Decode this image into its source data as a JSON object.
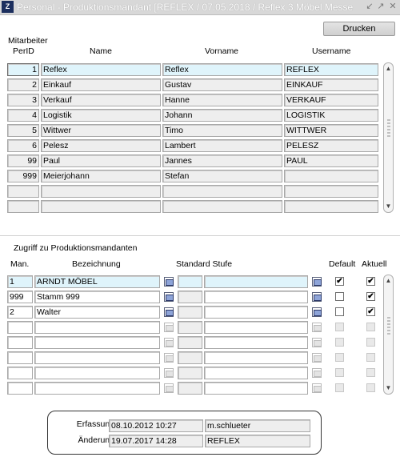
{
  "window": {
    "icon_label": "Z",
    "title": "Personal - Produktionsmandant  [REFLEX / 07.05.2018 / Reflex 3 Möbel Messe"
  },
  "toolbar": {
    "print_label": "Drucken"
  },
  "personal": {
    "label_top": "Mitarbeiter",
    "columns": {
      "perid": "PerID",
      "name": "Name",
      "vorname": "Vorname",
      "username": "Username"
    },
    "rows": [
      {
        "perid": "1",
        "name": "Reflex",
        "vorname": "Reflex",
        "username": "REFLEX"
      },
      {
        "perid": "2",
        "name": "Einkauf",
        "vorname": "Gustav",
        "username": "EINKAUF"
      },
      {
        "perid": "3",
        "name": "Verkauf",
        "vorname": "Hanne",
        "username": "VERKAUF"
      },
      {
        "perid": "4",
        "name": "Logistik",
        "vorname": "Johann",
        "username": "LOGISTIK"
      },
      {
        "perid": "5",
        "name": "Wittwer",
        "vorname": "Timo",
        "username": "WITTWER"
      },
      {
        "perid": "6",
        "name": "Pelesz",
        "vorname": "Lambert",
        "username": "PELESZ"
      },
      {
        "perid": "99",
        "name": "Paul",
        "vorname": "Jannes",
        "username": "PAUL"
      },
      {
        "perid": "999",
        "name": "Meierjohann",
        "vorname": "Stefan",
        "username": ""
      },
      {
        "perid": "",
        "name": "",
        "vorname": "",
        "username": ""
      },
      {
        "perid": "",
        "name": "",
        "vorname": "",
        "username": ""
      }
    ]
  },
  "zugriff": {
    "section_title": "Zugriff zu Produktionsmandanten",
    "columns": {
      "man": "Man.",
      "bezeichnung": "Bezeichnung",
      "standard_stufe": "Standard Stufe",
      "default": "Default",
      "aktuell": "Aktuell"
    },
    "rows": [
      {
        "man": "1",
        "bezeichnung": "ARNDT MÖBEL",
        "stufe_code": "",
        "stufe_name": "",
        "default": true,
        "aktuell": true
      },
      {
        "man": "999",
        "bezeichnung": "Stamm 999",
        "stufe_code": "",
        "stufe_name": "",
        "default": false,
        "aktuell": true
      },
      {
        "man": "2",
        "bezeichnung": "Walter",
        "stufe_code": "",
        "stufe_name": "",
        "default": false,
        "aktuell": true
      },
      {
        "man": "",
        "bezeichnung": "",
        "stufe_code": "",
        "stufe_name": "",
        "default": false,
        "aktuell": false
      },
      {
        "man": "",
        "bezeichnung": "",
        "stufe_code": "",
        "stufe_name": "",
        "default": false,
        "aktuell": false
      },
      {
        "man": "",
        "bezeichnung": "",
        "stufe_code": "",
        "stufe_name": "",
        "default": false,
        "aktuell": false
      },
      {
        "man": "",
        "bezeichnung": "",
        "stufe_code": "",
        "stufe_name": "",
        "default": false,
        "aktuell": false
      },
      {
        "man": "",
        "bezeichnung": "",
        "stufe_code": "",
        "stufe_name": "",
        "default": false,
        "aktuell": false
      }
    ]
  },
  "audit": {
    "erfassung_label": "Erfassung",
    "erfassung_date": "08.10.2012 10:27",
    "erfassung_user": "m.schlueter",
    "aenderung_label": "Änderung",
    "aenderung_date": "19.07.2017 14:28",
    "aenderung_user": "REFLEX"
  },
  "colors": {
    "highlight_row": "#dff4fb",
    "field_bg": "#eeeeee",
    "lov_icon": "#8ea4d8"
  },
  "icons": [
    "app-icon",
    "minimize-icon",
    "restore-icon",
    "close-icon",
    "scroll-up-icon",
    "scroll-down-icon",
    "list-of-values-icon",
    "checkmark-icon"
  ]
}
